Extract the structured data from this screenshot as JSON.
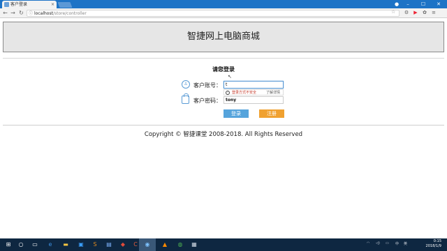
{
  "browser": {
    "tab_title": "客户登录",
    "tab_close": "×",
    "url_host": "localhost",
    "url_path": "/store/controller",
    "window_min": "–",
    "window_max": "☐",
    "window_close": "✕"
  },
  "page": {
    "site_title": "智捷网上电脑商城",
    "login_title": "请您登录",
    "account_label": "客户账号：",
    "account_value": "t",
    "password_label": "客户密码：",
    "password_value": "tony",
    "warning_text": "登录方式不安全",
    "warning_link": "了解详情",
    "login_button": "登录",
    "register_button": "注册",
    "footer": "Copyright © 智捷课堂 2008-2018. All Rights Reserved"
  },
  "taskbar": {
    "time": "0:15",
    "date": "2018/1/9",
    "ime": "中",
    "lang": "英"
  },
  "colors": {
    "tabbar": "#1d73c6",
    "login_button": "#56a4dc",
    "register_button": "#f0a130",
    "taskbar": "#0e2741"
  }
}
